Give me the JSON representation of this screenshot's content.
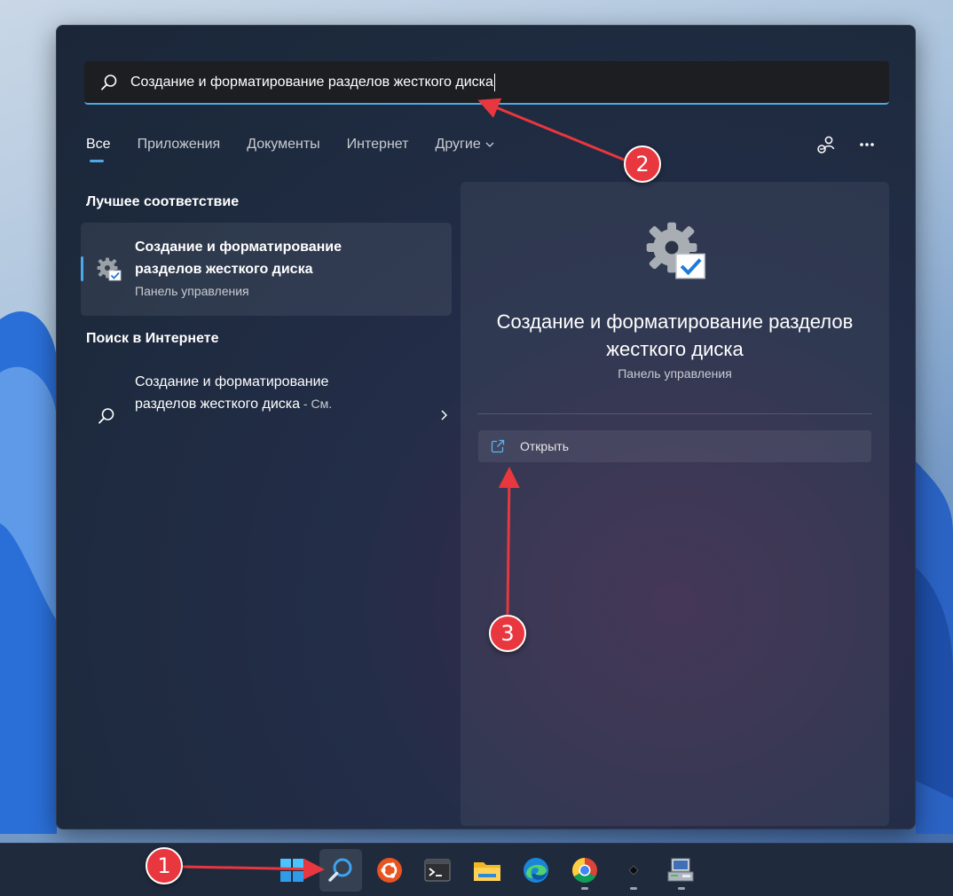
{
  "search": {
    "query": "Создание и форматирование разделов жесткого диска"
  },
  "tabs": [
    {
      "label": "Все"
    },
    {
      "label": "Приложения"
    },
    {
      "label": "Документы"
    },
    {
      "label": "Интернет"
    },
    {
      "label": "Другие"
    }
  ],
  "best_match": {
    "section_title": "Лучшее соответствие",
    "title_line1": "Создание и форматирование",
    "title_line2": "разделов жесткого диска",
    "subtitle": "Панель управления"
  },
  "web_search": {
    "section_title": "Поиск в Интернете",
    "title_line1": "Создание и форматирование",
    "title_line2": "разделов жесткого диска",
    "suffix": " - См."
  },
  "preview": {
    "title_line1": "Создание и форматирование разделов",
    "title_line2": "жесткого диска",
    "subtitle": "Панель управления",
    "open_label": "Открыть"
  },
  "callouts": [
    "1",
    "2",
    "3"
  ],
  "colors": {
    "accent": "#4fa9e6",
    "callout_red": "#e8373e",
    "panel_bg": "#1d2a3d",
    "taskbar_bg": "#1f2b3d"
  },
  "icons": {
    "search": "search-icon",
    "settings_gear": "gear-check-icon",
    "open_external": "open-external-icon",
    "more": "more-icon",
    "account": "account-icon"
  }
}
